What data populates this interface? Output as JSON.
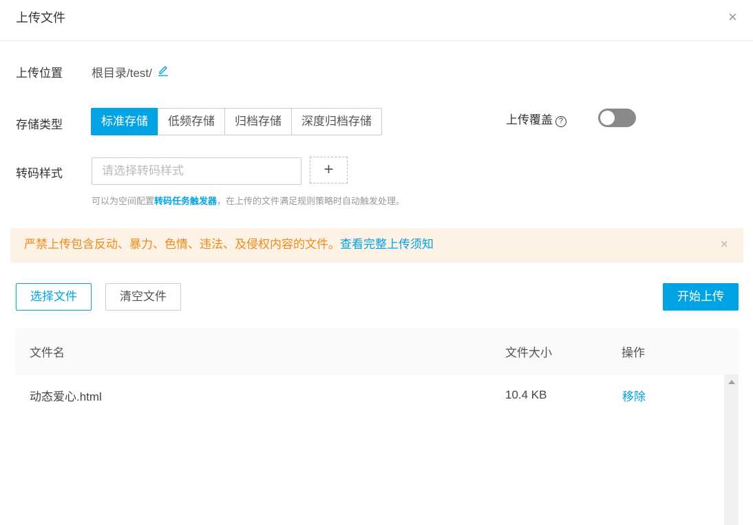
{
  "dialog": {
    "title": "上传文件",
    "close": "×"
  },
  "form": {
    "location_label": "上传位置",
    "location_value": "根目录/test/",
    "storage_label": "存储类型",
    "storage_options": [
      "标准存储",
      "低频存储",
      "归档存储",
      "深度归档存储"
    ],
    "storage_selected": "标准存储",
    "overwrite_label": "上传覆盖",
    "overwrite_on": false,
    "transcode_label": "转码样式",
    "transcode_placeholder": "请选择转码样式",
    "add": "+",
    "hint_prefix": "可以为空间配置",
    "hint_link": "转码任务触发器",
    "hint_suffix": "，在上传的文件满足规则策略时自动触发处理。"
  },
  "notice": {
    "text": "严禁上传包含反动、暴力、色情、违法、及侵权内容的文件。",
    "link": "查看完整上传须知",
    "close": "×"
  },
  "actions": {
    "select": "选择文件",
    "clear": "清空文件",
    "start": "开始上传"
  },
  "table": {
    "headers": [
      "文件名",
      "文件大小",
      "操作"
    ],
    "rows": [
      {
        "name": "动态爱心.html",
        "size": "10.4 KB",
        "action": "移除"
      }
    ]
  },
  "colors": {
    "accent": "#00a4e4",
    "warning": "#f08a1a",
    "notice_bg": "#fdf2e6"
  }
}
